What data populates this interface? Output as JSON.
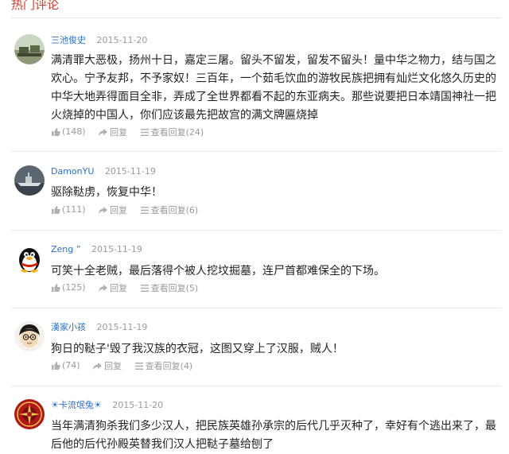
{
  "section_title": "热门评论",
  "comments": [
    {
      "user": "三池俊史",
      "time": "2015-11-20",
      "content": "满清罪大恶极，扬州十日，嘉定三屠。留头不留发，留发不留头！量中华之物力，结与国之欢心。宁予友邦，不予家奴！三百年，一个茹毛饮血的游牧民族把拥有灿烂文化悠久历史的中华大地弄得面目全非，弄成了全世界都看不起的东亚病夫。那些说要把日本靖国神社一把火烧掉的中国人，你们应该最先把故宫的满文牌匾烧掉",
      "likes": "(148)",
      "reply": "回复",
      "view_replies": "查看回复(24)",
      "avatar": "military-vehicles-avatar"
    },
    {
      "user": "DamonYU",
      "time": "2015-11-19",
      "content": "驱除鞑虏，恢复中华！",
      "likes": "(111)",
      "reply": "回复",
      "view_replies": "查看回复(6)",
      "avatar": "warship-avatar"
    },
    {
      "user": "Zeng ”",
      "time": "2015-11-19",
      "content": "可笑十全老贼，最后落得个被人挖坟掘墓，连尸首都难保全的下场。",
      "likes": "(125)",
      "reply": "回复",
      "view_replies": "查看回复(5)",
      "avatar": "penguin-avatar"
    },
    {
      "user": "漢家小孩",
      "time": "2015-11-19",
      "content": "狗日的鞑子'毁了我汉族的衣冠，这图又穿上了汉服，贼人！",
      "likes": "(74)",
      "reply": "回复",
      "view_replies": "查看回复(4)",
      "avatar": "cartoon-boy-avatar"
    },
    {
      "user": "☀卡流氓兔☀",
      "time": "2015-11-20",
      "content": "当年满清狗杀我们多少汉人，把民族英雄孙承宗的后代几乎灭种了，幸好有个逃出来了，最后他的后代孙殿英替我们汉人把鞑子墓给刨了",
      "avatar": "red-pattern-avatar"
    }
  ],
  "colors": {
    "accent": "#d13b2f",
    "username": "#2a6fc9",
    "muted": "#9a9a9a"
  }
}
